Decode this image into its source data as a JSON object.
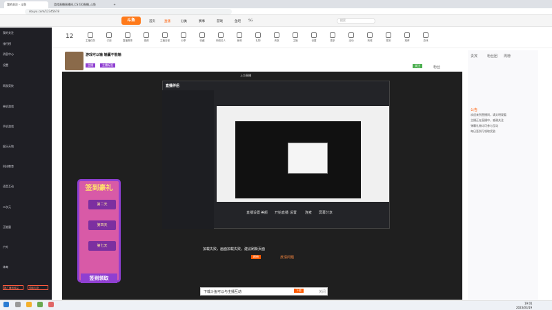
{
  "browser": {
    "tabs": [
      "我的关注 - 斗鱼",
      "游戏直播直播间_CS:GO直播_斗鱼",
      "",
      "更多"
    ],
    "url": "douyu.com/12345678",
    "tab_icon": "+"
  },
  "topnav": {
    "logo": "斗鱼",
    "items": [
      "首页",
      "直播",
      "分类",
      "赛事",
      "游戏",
      "鱼吧",
      "5G"
    ],
    "search": "搜索"
  },
  "categories": [
    "12",
    "主播任务",
    "订阅",
    "直播赛事",
    "视频",
    "主播日程",
    "分享",
    "收藏",
    "网络红人",
    "鱼吧",
    "礼物",
    "贵族",
    "主播",
    "设置",
    "更多",
    "活动",
    "商城",
    "签到",
    "推荐",
    "游戏",
    "星光",
    "热门",
    "直播回放",
    "热点新闻",
    "分享礼包",
    "更多内容"
  ],
  "room": {
    "title": "游戏可以输 输赢不能输",
    "tags": [
      "主播",
      "主播标签"
    ],
    "follow": "关注",
    "fans": "粉丝"
  },
  "sidebar": {
    "items": [
      "我的关注",
      "排行榜",
      "消息中心",
      "设置",
      "网游竞技",
      "单机游戏",
      "手机游戏",
      "娱乐天地",
      "科技教育",
      "语音互动",
      "二次元",
      "正能量",
      "户外",
      "体育"
    ],
    "red": [
      "推广赚钱收益",
      "领取礼物"
    ]
  },
  "inner_app": {
    "title": "直播伴侣",
    "subtitle": "上方直播",
    "actions": [
      "直播设置",
      "美颜",
      "开始直播",
      "设置",
      "连麦",
      "屏幕分享"
    ],
    "bottom": "加载失败，画面加载失败，建议刷新页面",
    "bottom_btns": [
      "刷新",
      "反馈问题"
    ]
  },
  "sign_in": {
    "title": "签到豪礼",
    "days": [
      "第二天",
      "第四天",
      "第七天"
    ],
    "button": "签到领取"
  },
  "right_panel": {
    "tabs": [
      "贵宾",
      "粉丝团",
      "周榜"
    ],
    "chat": [
      "欢迎来到直播间，请文明观看",
      "主播正在直播中，感谢关注",
      "弹幕礼物均可参与互动",
      "每日签到可领取奖励"
    ],
    "notice": "公告"
  },
  "bottom_bar": {
    "text": "下载斗鱼可以与主播互动",
    "btns": [
      "下载",
      "关闭"
    ]
  },
  "taskbar": {
    "time": "19:01",
    "date": "2023/03/19"
  }
}
